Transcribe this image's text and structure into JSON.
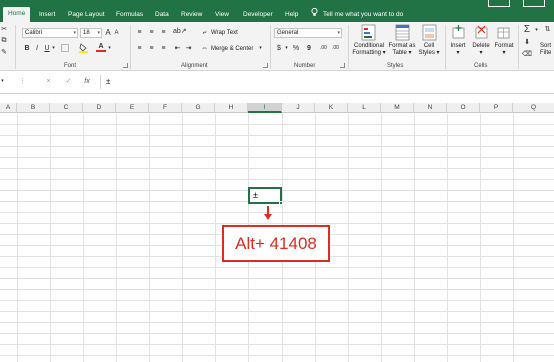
{
  "tabs": [
    "Home",
    "Insert",
    "Page Layout",
    "Formulas",
    "Data",
    "Review",
    "View",
    "Developer",
    "Help"
  ],
  "active_tab": "Home",
  "tell_me": "Tell me what you want to do",
  "font": {
    "name": "Calibri",
    "size": "18",
    "bold": "B",
    "italic": "I",
    "underline": "U",
    "grow": "A",
    "shrink": "A",
    "font_color": "A",
    "fill": "A",
    "label": "Font"
  },
  "alignment": {
    "wrap_text": "Wrap Text",
    "merge_center": "Merge & Center",
    "label": "Alignment"
  },
  "number": {
    "format": "General",
    "currency": "$",
    "percent": "%",
    "comma": "9",
    "inc_dec": ".00",
    "label": "Number"
  },
  "styles": {
    "conditional": "Conditional",
    "conditional2": "Formatting",
    "format_as": "Format as",
    "format_as2": "Table",
    "cell": "Cell",
    "cell2": "Styles",
    "label": "Styles"
  },
  "cells": {
    "insert": "Insert",
    "delete": "Delete",
    "format": "Format",
    "label": "Cells"
  },
  "editing": {
    "sort": "Sort",
    "filter": "Filte"
  },
  "formula_bar": {
    "cancel": "×",
    "enter": "✓",
    "fx": "fx",
    "value": "±"
  },
  "columns": [
    "A",
    "B",
    "C",
    "D",
    "E",
    "F",
    "G",
    "H",
    "I",
    "J",
    "K",
    "L",
    "M",
    "N",
    "O",
    "P",
    "Q"
  ],
  "selected_column": "I",
  "active_cell_value": "±",
  "callout": "Alt+ 41408",
  "colors": {
    "brand_green": "#217346",
    "callout_red": "#e02b20"
  }
}
